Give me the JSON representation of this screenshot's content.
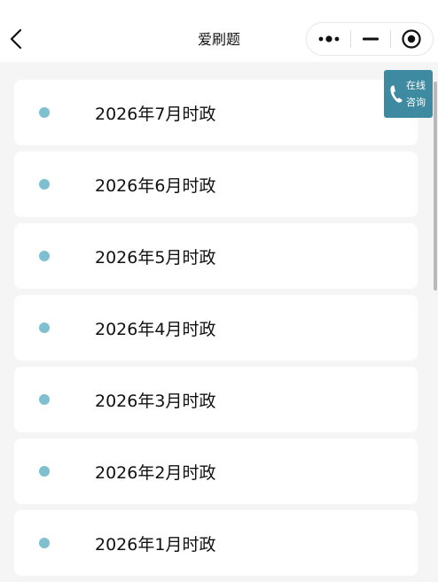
{
  "navbar": {
    "title": "爱刷题",
    "back_icon": "chevron-left-icon",
    "more_icon": "more-dots-icon",
    "minimize_icon": "minimize-icon",
    "close_icon": "target-circle-icon"
  },
  "consult": {
    "line1": "在线",
    "line2": "咨询",
    "icon": "phone-icon",
    "bg_color": "#3e8aa0"
  },
  "list": {
    "dot_color": "#7ec0cf",
    "items": [
      {
        "label": "2026年7月时政"
      },
      {
        "label": "2026年6月时政"
      },
      {
        "label": "2026年5月时政"
      },
      {
        "label": "2026年4月时政"
      },
      {
        "label": "2026年3月时政"
      },
      {
        "label": "2026年2月时政"
      },
      {
        "label": "2026年1月时政"
      }
    ]
  },
  "colors": {
    "page_bg": "#f5f5f5",
    "card_bg": "#ffffff"
  }
}
